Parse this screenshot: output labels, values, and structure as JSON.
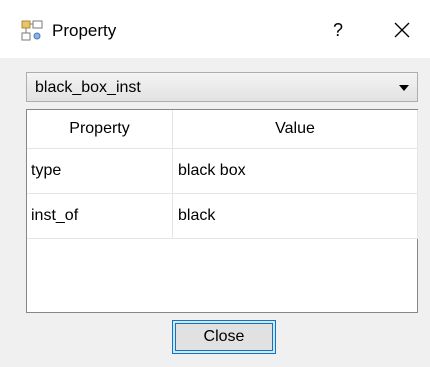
{
  "window": {
    "title": "Property",
    "help_label": "?",
    "app_icon": "property-tree-icon",
    "close_icon": "close-icon"
  },
  "selector": {
    "selected_value": "black_box_inst",
    "arrow_icon": "dropdown-arrow-icon"
  },
  "table": {
    "headers": [
      "Property",
      "Value"
    ],
    "rows": [
      {
        "property": "type",
        "value": "black box"
      },
      {
        "property": "inst_of",
        "value": "black"
      }
    ]
  },
  "footer": {
    "close_label": "Close"
  },
  "colors": {
    "accent": "#0078d7",
    "dialog_bg": "#f0f0f0"
  }
}
